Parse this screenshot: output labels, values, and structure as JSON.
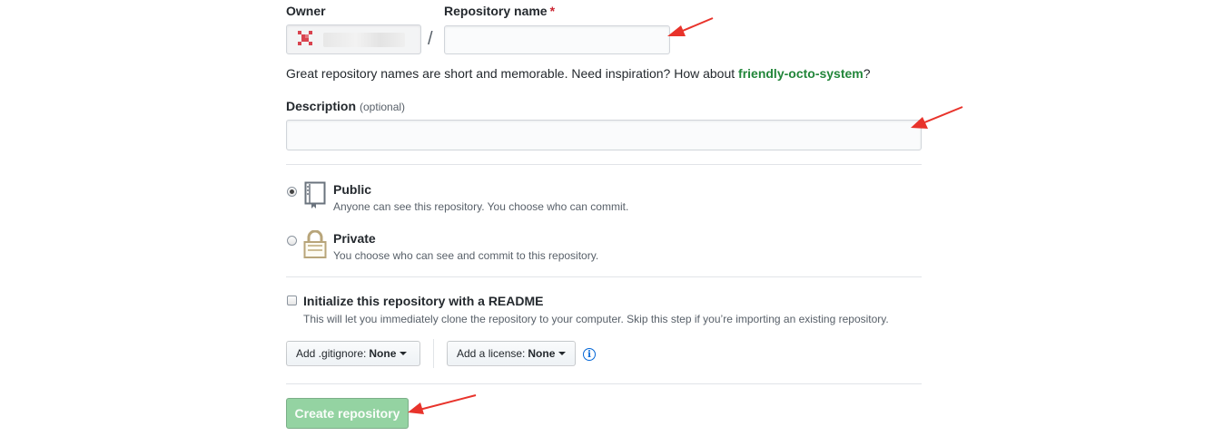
{
  "owner": {
    "label": "Owner"
  },
  "repo_name": {
    "label": "Repository name",
    "required_marker": "*",
    "value": "",
    "slash": "/"
  },
  "name_hint": {
    "text": "Great repository names are short and memorable. Need inspiration? How about ",
    "suggestion": "friendly-octo-system",
    "suffix": "?"
  },
  "description": {
    "label": "Description",
    "optional": "(optional)",
    "value": ""
  },
  "visibility": {
    "public": {
      "title": "Public",
      "note": "Anyone can see this repository. You choose who can commit.",
      "selected": true
    },
    "private": {
      "title": "Private",
      "note": "You choose who can see and commit to this repository.",
      "selected": false
    }
  },
  "readme": {
    "title": "Initialize this repository with a README",
    "note": "This will let you immediately clone the repository to your computer. Skip this step if you’re importing an existing repository.",
    "checked": false
  },
  "gitignore": {
    "label": "Add .gitignore:",
    "value": "None"
  },
  "license": {
    "label": "Add a license:",
    "value": "None"
  },
  "info_icon": "info-icon",
  "create_button": {
    "label": "Create repository",
    "disabled": true
  },
  "colors": {
    "accent_green": "#22863a",
    "create_button_bg": "#94d3a2",
    "annotation_arrow": "#e8332b",
    "required": "#cb2431",
    "info_blue": "#0366d6"
  }
}
